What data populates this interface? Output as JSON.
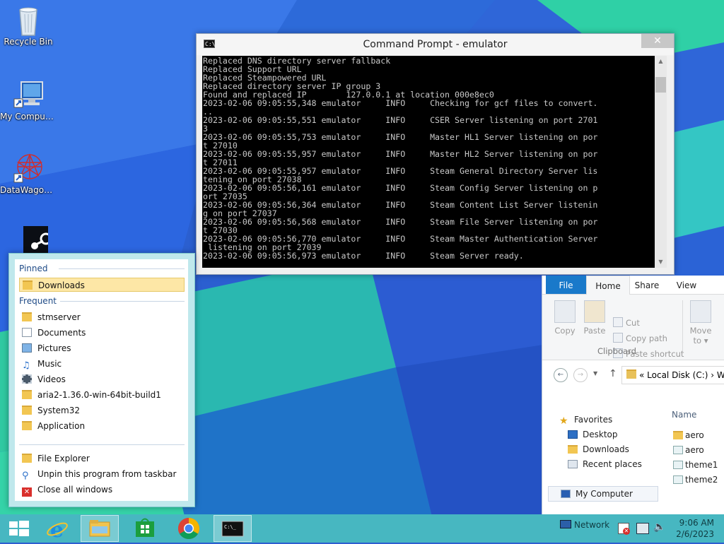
{
  "desktop": {
    "icons": [
      {
        "label": "Recycle Bin"
      },
      {
        "label": "My Computer"
      },
      {
        "label": "DataWagon..."
      }
    ]
  },
  "cmd": {
    "title": "Command Prompt - emulator",
    "icon_text": "C:\\",
    "lines": [
      "Replaced DNS directory server fallback",
      "Replaced Support URL",
      "Replaced Steampowered URL",
      "Replaced directory server IP group 3",
      "Found and replaced IP        127.0.0.1 at location 000e8ec0",
      "2023-02-06 09:05:55,348 emulator     INFO     Checking for gcf files to convert.",
      "..",
      "2023-02-06 09:05:55,551 emulator     INFO     CSER Server listening on port 2701",
      "3",
      "2023-02-06 09:05:55,753 emulator     INFO     Master HL1 Server listening on por",
      "t 27010",
      "2023-02-06 09:05:55,957 emulator     INFO     Master HL2 Server listening on por",
      "t 27011",
      "2023-02-06 09:05:55,957 emulator     INFO     Steam General Directory Server lis",
      "tening on port 27038",
      "2023-02-06 09:05:56,161 emulator     INFO     Steam Config Server listening on p",
      "ort 27035",
      "2023-02-06 09:05:56,364 emulator     INFO     Steam Content List Server listenin",
      "g on port 27037",
      "2023-02-06 09:05:56,568 emulator     INFO     Steam File Server listening on por",
      "t 27030",
      "2023-02-06 09:05:56,770 emulator     INFO     Steam Master Authentication Server",
      " listening on port 27039",
      "2023-02-06 09:05:56,973 emulator     INFO     Steam Server ready."
    ]
  },
  "explorer": {
    "tabs": {
      "file": "File",
      "home": "Home",
      "share": "Share",
      "view": "View"
    },
    "ribbon": {
      "copy": "Copy",
      "paste": "Paste",
      "cut": "Cut",
      "copy_path": "Copy path",
      "paste_shortcut": "Paste shortcut",
      "clipboard": "Clipboard",
      "move_to_1": "Move",
      "move_to_2": "to ▾"
    },
    "address": "«  Local Disk (C:)  › W",
    "nav": {
      "favorites": "Favorites",
      "desktop": "Desktop",
      "downloads": "Downloads",
      "recent": "Recent places",
      "mycomputer": "My Computer"
    },
    "list_header": "Name",
    "files": [
      "aero",
      "aero",
      "theme1",
      "theme2"
    ]
  },
  "jumplist": {
    "pinned_header": "Pinned",
    "pinned": [
      "Downloads"
    ],
    "frequent_header": "Frequent",
    "frequent": [
      "stmserver",
      "Documents",
      "Pictures",
      "Music",
      "Videos",
      "aria2-1.36.0-win-64bit-build1",
      "System32",
      "Application"
    ],
    "tasks": {
      "file_explorer": "File Explorer",
      "unpin": "Unpin this program from taskbar",
      "close_all": "Close all windows"
    }
  },
  "taskbar": {
    "network": "Network",
    "time": "9:06 AM",
    "date": "2/6/2023"
  },
  "colors": {
    "taskbar": "#47b7c1",
    "jumplist_frame": "#bfe8ec",
    "ribbon_file_tab": "#1979ca"
  }
}
